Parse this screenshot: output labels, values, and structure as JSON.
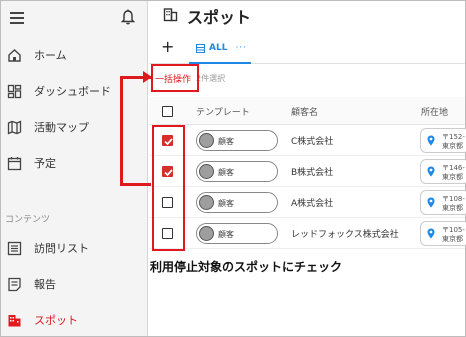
{
  "sidebar": {
    "items": [
      {
        "label": "ホーム",
        "icon": "home-icon"
      },
      {
        "label": "ダッシュボード",
        "icon": "dashboard-icon"
      },
      {
        "label": "活動マップ",
        "icon": "map-icon"
      },
      {
        "label": "予定",
        "icon": "calendar-icon"
      }
    ],
    "section_label": "コンテンツ",
    "content_items": [
      {
        "label": "訪問リスト",
        "icon": "list-icon"
      },
      {
        "label": "報告",
        "icon": "report-icon"
      },
      {
        "label": "スポット",
        "icon": "building-icon",
        "active": true
      }
    ]
  },
  "page": {
    "title": "スポット"
  },
  "tabs": {
    "add_label": "+",
    "all_label": "ALL",
    "more_label": "···"
  },
  "toolbar": {
    "bulk_label": "一括操作",
    "selected_count": "2件選択"
  },
  "table": {
    "columns": [
      "テンプレート",
      "顧客名",
      "所在地"
    ],
    "rows": [
      {
        "checked": true,
        "template": "顧客",
        "customer": "C株式会社",
        "loc1": "〒152-",
        "loc2": "東京都"
      },
      {
        "checked": true,
        "template": "顧客",
        "customer": "B株式会社",
        "loc1": "〒146-",
        "loc2": "東京都"
      },
      {
        "checked": false,
        "template": "顧客",
        "customer": "A株式会社",
        "loc1": "〒108-",
        "loc2": "東京都"
      },
      {
        "checked": false,
        "template": "顧客",
        "customer": "レッドフォックス株式会社",
        "loc1": "〒105-",
        "loc2": "東京都"
      }
    ]
  },
  "caption": "利用停止対象のスポットにチェック",
  "colors": {
    "accent_red": "#e0191f",
    "tab_blue": "#1e88e5",
    "check_red": "#d32f2f",
    "pin_blue": "#1e88e5"
  }
}
